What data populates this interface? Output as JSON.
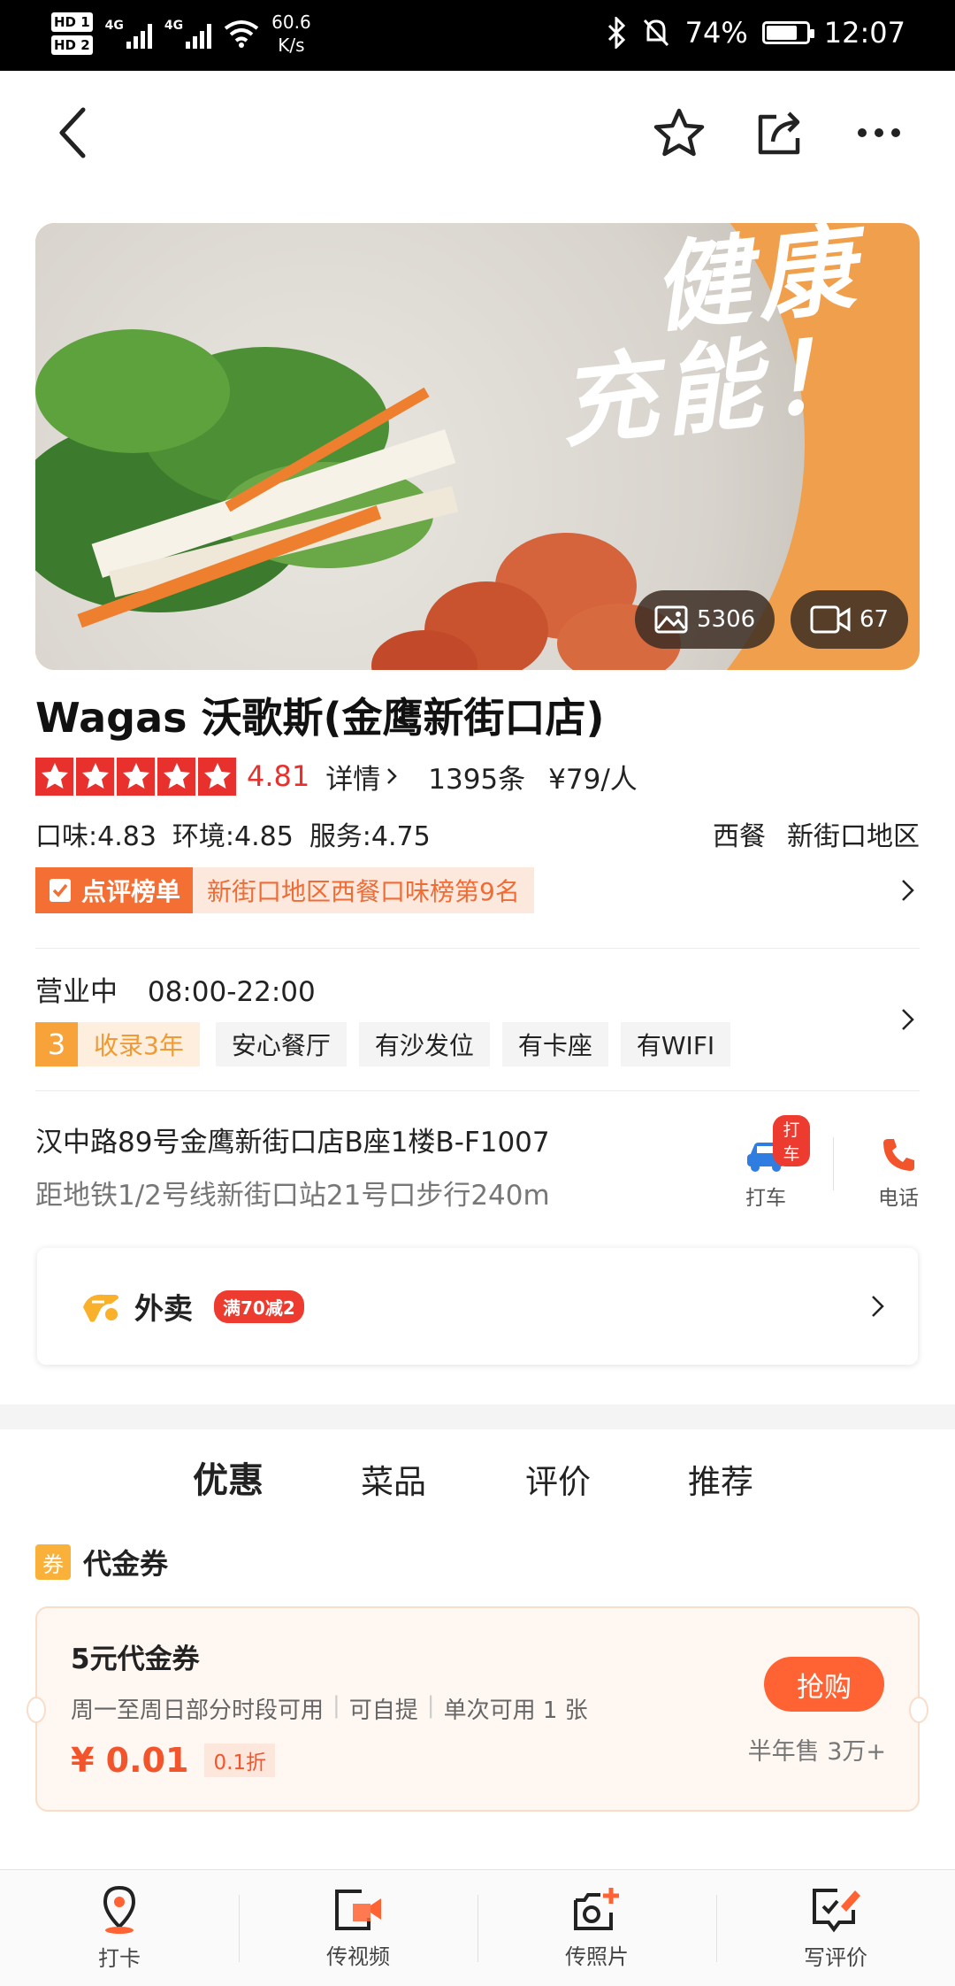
{
  "status_bar": {
    "hd1": "HD 1",
    "hd2": "HD 2",
    "net1": "4G",
    "net2": "4G",
    "speed_value": "60.6",
    "speed_unit": "K/s",
    "battery": "74%",
    "time": "12:07"
  },
  "nav": {
    "back_icon": "chevron-left-icon",
    "favorite_icon": "star-outline-icon",
    "share_icon": "share-icon",
    "more_icon": "more-dots-icon"
  },
  "hero": {
    "slogan_line1": "健康",
    "slogan_line2": "充能！",
    "photos_count": "5306",
    "videos_count": "67"
  },
  "shop": {
    "name": "Wagas 沃歌斯(金鹰新街口店)",
    "rating": "4.81",
    "stars": 5,
    "details_label": "详情",
    "review_count": "1395条",
    "price_per_person": "¥79/人",
    "taste": "口味:4.83",
    "environment": "环境:4.85",
    "service": "服务:4.75",
    "category": "西餐",
    "district": "新街口地区",
    "rank_tag": "点评榜单",
    "rank_text": "新街口地区西餐口味榜第9名"
  },
  "business": {
    "status": "营业中",
    "hours": "08:00-22:00",
    "years_num": "3",
    "years_text": "收录3年",
    "tags": [
      "安心餐厅",
      "有沙发位",
      "有卡座",
      "有WIFI"
    ]
  },
  "location": {
    "address": "汉中路89号金鹰新街口店B座1楼B-F1007",
    "metro": "距地铁1/2号线新街口站21号口步行240m",
    "taxi_badge": "打车",
    "taxi_label": "打车",
    "phone_label": "电话"
  },
  "delivery": {
    "title": "外卖",
    "promo": "满70减2"
  },
  "tabs": [
    {
      "label": "优惠",
      "active": true
    },
    {
      "label": "菜品",
      "active": false
    },
    {
      "label": "评价",
      "active": false
    },
    {
      "label": "推荐",
      "active": false
    }
  ],
  "voucher_section": {
    "icon_text": "券",
    "title": "代金券"
  },
  "voucher": {
    "title": "5元代金券",
    "desc1": "周一至周日部分时段可用",
    "desc2": "可自提",
    "desc3": "单次可用 1 张",
    "price": "¥ 0.01",
    "discount": "0.1折",
    "buy_label": "抢购",
    "sold": "半年售 3万+"
  },
  "bottom_bar": [
    {
      "label": "打卡",
      "icon": "location-pin-icon"
    },
    {
      "label": "传视频",
      "icon": "video-upload-icon"
    },
    {
      "label": "传照片",
      "icon": "camera-add-icon"
    },
    {
      "label": "写评价",
      "icon": "write-review-icon"
    }
  ],
  "colors": {
    "accent": "#ff6333",
    "star_red": "#e8302d",
    "rank_orange": "#f36f34",
    "years_orange": "#f7a33a"
  }
}
